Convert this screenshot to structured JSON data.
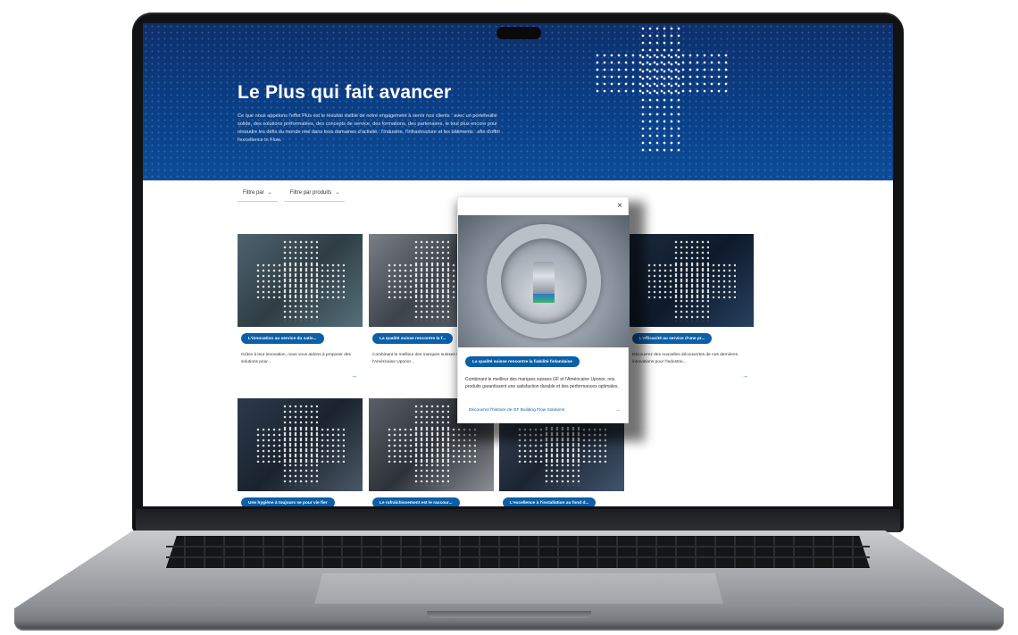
{
  "hero": {
    "title": "Le Plus qui fait avancer",
    "description": "Ce que nous appelons l'effet Plus est le résultat visible de notre engagement à servir nos clients : avec un portefeuille solide, des solutions préformatées, des concepts de service, des formations, des partenaires, le tout plus encore pour résoudre les défis du monde réel dans trois domaines d'activité : l'Industrie, l'Infrastructure et les bâtiments : afin d'offrir l'excellence in Flow."
  },
  "filters": [
    {
      "label": "Filtre par"
    },
    {
      "label": "Filtre par produits"
    }
  ],
  "cards": [
    {
      "pill": "L'innovation au service du satis...",
      "text": "Grâce à leur innovation, nous vous aidons à proposer des solutions pour..."
    },
    {
      "pill": "La qualité suisse rencontre la f...",
      "text": "Combinant le meilleur des marques suisses GF et l'Américaine Uponor..."
    },
    {
      "pill": "L'efficacité au service d'une pr...",
      "text": "Découvrez des nouvelles découvertes de nos dernières innovations pour l'industrie..."
    },
    {
      "pill": "Une hygiène à toujours se pour vie fier",
      "text": ""
    },
    {
      "pill": "Le rafraîchissement est le raccour...",
      "text": ""
    },
    {
      "pill": "L'excellence à l'installation au fond d...",
      "text": ""
    }
  ],
  "modal": {
    "close": "×",
    "pill": "La qualité suisse rencontre la fiabilité finlandaise",
    "text": "Combinant le meilleur des marques suisses GF et l'Américaine Uponor, nos produits garantissent une satisfaction durable et des performances optimales.",
    "link": "Découvrez l'histoire de GF Building Flow Solutions",
    "link_arrow": "→"
  },
  "colors": {
    "hero_bg": "#0a3f86",
    "accent": "#0a5fa8",
    "bezel": "#111214",
    "chassis": "#a9abaf"
  },
  "icons": {
    "close": "close-icon",
    "chevron": "chevron-down-icon",
    "arrow": "arrow-right-icon"
  }
}
